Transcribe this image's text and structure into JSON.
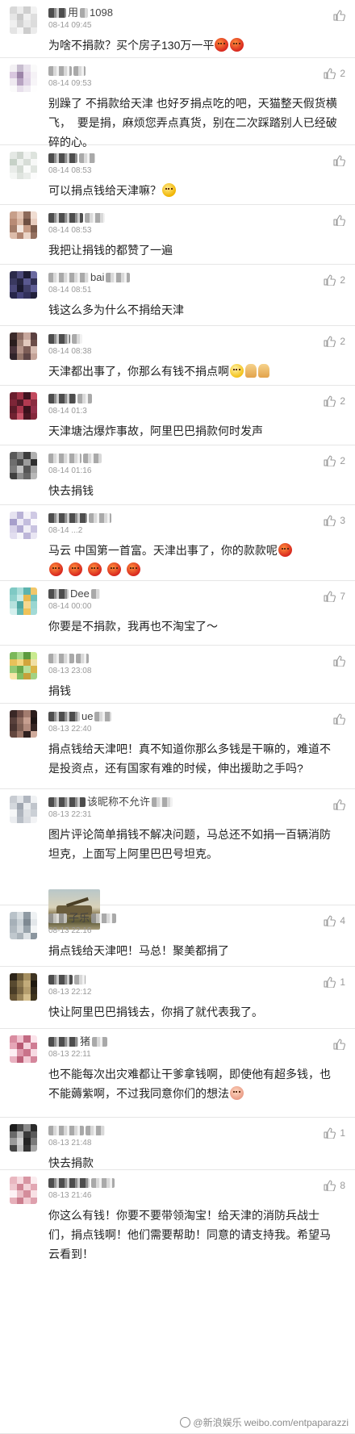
{
  "comments": [
    {
      "name_visible": "用",
      "name_tail": "1098",
      "time": "08-14 09:45",
      "text": "为啥不捐款？买个房子130万一平",
      "likes": "",
      "emoji_after": [
        "angry-emoji",
        "angry-emoji"
      ],
      "avatar": [
        "#d8d8d8",
        "#ececec",
        "#cfcfcf",
        "#f2f2f2",
        "#e6e6e6",
        "#c9c9c9",
        "#efefef",
        "#dedede",
        "#f0f0f0",
        "#d2d2d2",
        "#e9e9e9",
        "#dcdcdc",
        "#e4e4e4",
        "#f6f6f6",
        "#cdcdcd",
        "#ebebeb"
      ]
    },
    {
      "name_visible": "",
      "name_tail": "",
      "time": "08-14 09:53",
      "text": "别躁了 不捐款给天津 也好歹捐点吃的吧，天猫整天假货横飞，  要是捐，麻烦您弄点真货，别在二次踩踏别人已经破碎的心。",
      "likes": "2",
      "emoji_after": [],
      "avatar": [
        "#f3f1f4",
        "#c7bdcf",
        "#e8e2ec",
        "#fafafa",
        "#d9c7df",
        "#9c84a8",
        "#e5d8e9",
        "#f5f2f6",
        "#efeaf1",
        "#b7a3c1",
        "#e0d4e6",
        "#f7f5f8",
        "#fbfbfb",
        "#e7dfeb",
        "#f1edf3",
        "#fefefe"
      ]
    },
    {
      "name_visible": "",
      "name_tail": "",
      "time": "08-14 08:53",
      "text": "可以捐点钱给天津嘛？",
      "likes": "",
      "emoji_after": [
        "cry-emoji"
      ],
      "avatar": [
        "#e4e8e4",
        "#cfd6cf",
        "#f1f3f1",
        "#dde3dd",
        "#c6d1c7",
        "#eef1ee",
        "#d7ddd7",
        "#f7f8f7",
        "#e9ece9",
        "#d3dad3",
        "#fafbfa",
        "#e0e5e0",
        "#f4f6f4",
        "#dfe4df",
        "#eaedea",
        "#fcfcfc"
      ]
    },
    {
      "name_visible": "",
      "name_tail": "",
      "time": "08-14 08:53",
      "text": "我把让捐钱的都赞了一遍",
      "likes": "",
      "emoji_after": [],
      "avatar": [
        "#c79f8a",
        "#e3c4b3",
        "#8d6a5a",
        "#f0ddd2",
        "#b88b75",
        "#d9b6a2",
        "#6e4f42",
        "#e8cdbf",
        "#a37c68",
        "#f3e6de",
        "#c59a84",
        "#7c5b4c",
        "#dcbcaa",
        "#b08571",
        "#ead4c7",
        "#94705f"
      ]
    },
    {
      "name_visible": "bai",
      "name_tail": "",
      "time": "08-14 08:51",
      "text": "钱这么多为什么不捐给天津",
      "likes": "2",
      "emoji_after": [],
      "avatar": [
        "#2b2a4a",
        "#4c4a7a",
        "#1e1d36",
        "#6b6aa0",
        "#3a3960",
        "#25243f",
        "#5a5990",
        "#2f2e52",
        "#4a4878",
        "#1b1a30",
        "#3f3e68",
        "#5e5d95",
        "#27264a",
        "#44437a",
        "#31305a",
        "#22213b"
      ]
    },
    {
      "name_visible": "",
      "name_tail": "",
      "time": "08-14 08:38",
      "text": "天津都出事了，你那么有钱不捐点啊",
      "likes": "2",
      "emoji_after": [
        "smile-emoji",
        "pray-emoji",
        "pray-emoji"
      ],
      "avatar": [
        "#3b2a2a",
        "#8a6a62",
        "#c7a79d",
        "#5a4040",
        "#2a1e1e",
        "#a08276",
        "#e2c9bd",
        "#6b4d48",
        "#48333a",
        "#b39287",
        "#7c5d56",
        "#d6bbb0",
        "#30232a",
        "#95766b",
        "#5e4545",
        "#c4a398"
      ]
    },
    {
      "name_visible": "",
      "name_tail": "",
      "time": "08-14 01:3",
      "text": "天津塘沽爆炸事故，阿里巴巴捐款何时发声",
      "likes": "2",
      "emoji_after": [],
      "avatar": [
        "#6a1e2e",
        "#9d3246",
        "#401420",
        "#c24a5e",
        "#7d2638",
        "#521a28",
        "#b13a50",
        "#8a2c40",
        "#5c1c2a",
        "#a7364c",
        "#3a121c",
        "#94304a",
        "#712232",
        "#c65468",
        "#4a1622",
        "#85283c"
      ]
    },
    {
      "name_visible": "",
      "name_tail": "",
      "time": "08-14 01:16",
      "text": "快去捐钱",
      "likes": "2",
      "emoji_after": [],
      "avatar": [
        "#5a5a5a",
        "#8a8a8a",
        "#3c3c3c",
        "#b0b0b0",
        "#6e6e6e",
        "#4a4a4a",
        "#9c9c9c",
        "#2e2e2e",
        "#7a7a7a",
        "#c2c2c2",
        "#555555",
        "#a4a4a4",
        "#404040",
        "#8e8e8e",
        "#666666",
        "#b8b8b8"
      ]
    },
    {
      "name_visible": "",
      "name_tail": "",
      "time": "08-14 ...2",
      "text": "马云 中国第一首富。天津出事了，你的款款呢",
      "likes": "3",
      "emoji_after": [
        "angry-emoji"
      ],
      "second_line_emoji": [
        "angry-emoji",
        "angry-emoji",
        "angry-emoji",
        "angry-emoji",
        "angry-emoji"
      ],
      "avatar": [
        "#e6e3f0",
        "#b9b2d6",
        "#f4f2f8",
        "#cfc9e4",
        "#a79fcb",
        "#ece9f4",
        "#c3bddd",
        "#faf9fc",
        "#d9d4ea",
        "#b2abd2",
        "#f0eef6",
        "#c8c2e0",
        "#e2def0",
        "#f7f6fa",
        "#bdb6d9",
        "#e9e6f3"
      ]
    },
    {
      "name_visible": "Dee",
      "name_tail": "",
      "time": "08-14 00:00",
      "text": "你要是不捐款，我再也不淘宝了～",
      "likes": "7",
      "emoji_after": [],
      "avatar": [
        "#7fc9c4",
        "#a9ddd9",
        "#5cb3ad",
        "#f1c76a",
        "#8fd1cc",
        "#c8ebe8",
        "#e8b94e",
        "#6fbfb9",
        "#b6e2de",
        "#4fa7a1",
        "#f6d88f",
        "#99d6d1",
        "#d5f0ee",
        "#66b8b2",
        "#efc259",
        "#a2dad6"
      ]
    },
    {
      "name_visible": "",
      "name_tail": "",
      "time": "08-13 23:08",
      "text": "捐钱",
      "likes": "",
      "emoji_after": [],
      "avatar": [
        "#7bb85a",
        "#a8d88a",
        "#5c9a3f",
        "#c9ea8f",
        "#e7c15a",
        "#f4d77e",
        "#d2a53c",
        "#f0e0a4",
        "#93c974",
        "#6aa84b",
        "#b7df99",
        "#d9b548",
        "#f7e6a8",
        "#83bf63",
        "#c6a03a",
        "#a3d283"
      ]
    },
    {
      "name_visible": "ue",
      "name_tail": "",
      "time": "08-13 22:40",
      "text": "捐点钱给天津吧！真不知道你那么多钱是干嘛的，难道不是投资点，还有国家有难的时候，伸出援助之手吗?",
      "likes": "",
      "emoji_after": [],
      "avatar": [
        "#3a2826",
        "#6e4d46",
        "#a27b6e",
        "#2a1c1b",
        "#58403b",
        "#8c6a5e",
        "#c79f90",
        "#1f1514",
        "#4a3531",
        "#7d5e53",
        "#b28b7d",
        "#352523",
        "#63473f",
        "#9a7568",
        "#2e201f",
        "#d0ab9c"
      ]
    },
    {
      "name_visible": "该昵称不允许",
      "name_tail": "",
      "time": "08-13 22:31",
      "text": "图片评论简单捐钱不解决问题，马总还不如捐一百辆消防坦克，上面写上阿里巴巴号坦克。",
      "likes": "",
      "emoji_after": [],
      "has_image": true,
      "avatar": [
        "#c8ccd2",
        "#e2e5e9",
        "#b0b6bf",
        "#f0f2f4",
        "#d4d8dd",
        "#9fa6b0",
        "#e8ebee",
        "#c0c5cc",
        "#f6f7f8",
        "#aeb4bd",
        "#dde0e4",
        "#cbd0d6",
        "#ebedf0",
        "#b8bec6",
        "#d9dce1",
        "#f2f3f5"
      ]
    },
    {
      "name_visible": "子乐",
      "name_tail": "",
      "time": "08-13 22:16",
      "text": "捐点钱给天津吧！马总！聚美都捐了",
      "likes": "4",
      "emoji_after": [],
      "avatar": [
        "#b9c2c9",
        "#d8dee2",
        "#8f9aa3",
        "#eef1f3",
        "#a6b0b8",
        "#c8d0d5",
        "#7e8992",
        "#e3e7ea",
        "#b0b9c0",
        "#d2d8dc",
        "#98a3ab",
        "#f3f5f6",
        "#c0c8ce",
        "#aab3ba",
        "#dde2e5",
        "#8a959e"
      ]
    },
    {
      "name_visible": "",
      "name_tail": "",
      "time": "08-13 22:12",
      "text": "快让阿里巴巴捐钱去，你捐了就代表我了。",
      "likes": "1",
      "emoji_after": [],
      "avatar": [
        "#2c2418",
        "#6a5a3a",
        "#a58f60",
        "#3e3322",
        "#584a30",
        "#8c784f",
        "#c2ab7a",
        "#1e180f",
        "#4a3d27",
        "#7a6744",
        "#b49d6d",
        "#332a1c",
        "#665435",
        "#9a855a",
        "#d3bd8c",
        "#40351f"
      ]
    },
    {
      "name_visible": "猪",
      "name_tail": "",
      "time": "08-13 22:11",
      "text": "也不能每次出灾难都让干爹拿钱啊，即使他有超多钱，也不能薅紫啊，不过我同意你们的想法",
      "likes": "",
      "emoji_after": [
        "baby-emoji"
      ],
      "avatar": [
        "#d98ca0",
        "#f0c2cf",
        "#c26a82",
        "#fbe3ea",
        "#e6a6b7",
        "#b85872",
        "#f4d2dc",
        "#cf7c93",
        "#fdeff3",
        "#dd98ab",
        "#c9738a",
        "#f7dbe3",
        "#e9b2c1",
        "#bd6079",
        "#f2c9d4",
        "#d4869b"
      ]
    },
    {
      "name_visible": "",
      "name_tail": "",
      "time": "08-13 21:48",
      "text": "快去捐款",
      "likes": "1",
      "emoji_after": [],
      "avatar": [
        "#1c1c1c",
        "#4a4a4a",
        "#8a8a8a",
        "#2a2a2a",
        "#6a6a6a",
        "#b5b5b5",
        "#3a3a3a",
        "#5a5a5a",
        "#9a9a9a",
        "#d0d0d0",
        "#242424",
        "#7a7a7a",
        "#444444",
        "#c0c0c0",
        "#333333",
        "#a5a5a5"
      ]
    },
    {
      "name_visible": "",
      "name_tail": "",
      "time": "08-13 21:46",
      "text": "你这么有钱！你要不要带领淘宝！给天津的消防兵战士们，捐点钱啊！他们需要帮助！同意的请支持我。希望马云看到！",
      "likes": "8",
      "emoji_after": [],
      "avatar": [
        "#e9b7c0",
        "#f6dbe0",
        "#d896a3",
        "#fbecef",
        "#efc8cf",
        "#cf8594",
        "#f3d2d8",
        "#e2a7b3",
        "#fdf3f5",
        "#eabec6",
        "#d48d9b",
        "#f8e1e5",
        "#e6b0ba",
        "#cc7e8e",
        "#f1cbd2",
        "#dea0ad"
      ]
    }
  ],
  "watermark": {
    "text": "weibo.com/entpaparazzi",
    "account": "@新浪娱乐",
    "icon": "weibo-logo-icon"
  },
  "icons": {
    "like": "thumbs-up-icon"
  },
  "colors": {
    "time": "#9a9a9a",
    "text": "#222222",
    "divider": "#e6e6e6"
  }
}
